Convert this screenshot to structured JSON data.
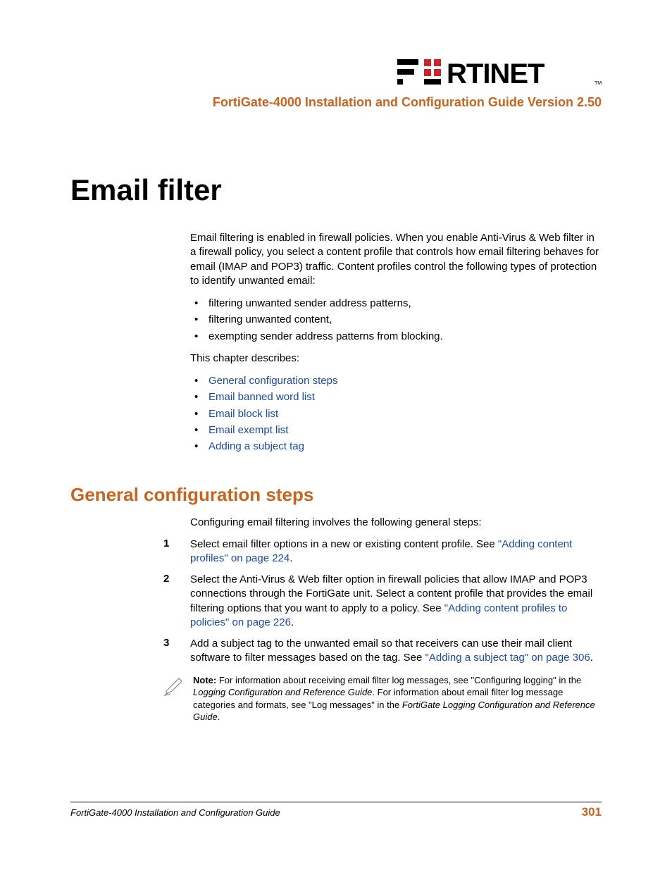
{
  "header": {
    "logo_alt": "FORTINET",
    "subtitle": "FortiGate-4000 Installation and Configuration Guide Version 2.50"
  },
  "chapter_title": "Email filter",
  "intro_paragraph": "Email filtering is enabled in firewall policies. When you enable Anti-Virus & Web filter in a firewall policy, you select a content profile that controls how email filtering behaves for email (IMAP and POP3) traffic. Content profiles control the following types of protection to identify unwanted email:",
  "intro_bullets": [
    "filtering unwanted sender address patterns,",
    "filtering unwanted content,",
    "exempting sender address patterns from blocking."
  ],
  "describes_label": "This chapter describes:",
  "toc_links": [
    "General configuration steps",
    "Email banned word list",
    "Email block list",
    "Email exempt list",
    "Adding a subject tag"
  ],
  "section": {
    "heading": "General configuration steps",
    "intro": "Configuring email filtering involves the following general steps:",
    "steps": [
      {
        "num": "1",
        "text_before": "Select email filter options in a new or existing content profile. See ",
        "link": "\"Adding content profiles\" on page 224",
        "text_after": "."
      },
      {
        "num": "2",
        "text_before": "Select the Anti-Virus & Web filter option in firewall policies that allow IMAP and POP3 connections through the FortiGate unit. Select a content profile that provides the email filtering options that you want to apply to a policy. See ",
        "link": "\"Adding content profiles to policies\" on page 226",
        "text_after": "."
      },
      {
        "num": "3",
        "text_before": "Add a subject tag to the unwanted email so that receivers can use their mail client software to filter messages based on the tag. See ",
        "link": "\"Adding a subject tag\" on page 306",
        "text_after": "."
      }
    ]
  },
  "note": {
    "label": "Note: ",
    "part1": "For information about receiving email filter log messages, see \"Configuring logging\" in the ",
    "italic1": "Logging Configuration and Reference Guide",
    "part2": ". For information about email filter log message categories and formats, see \"Log messages\" in the ",
    "italic2": "FortiGate Logging Configuration and Reference Guide",
    "part3": "."
  },
  "footer": {
    "left": "FortiGate-4000 Installation and Configuration Guide",
    "page_number": "301"
  }
}
